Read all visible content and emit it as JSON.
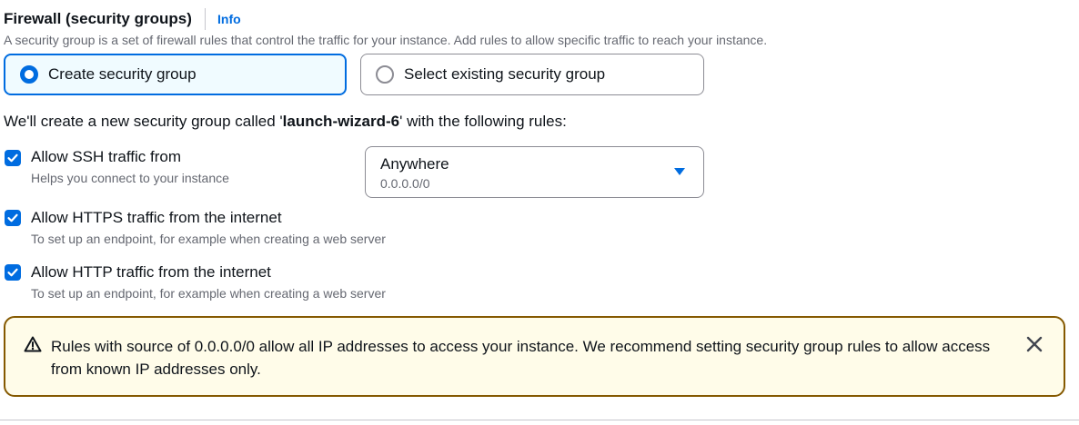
{
  "header": {
    "title": "Firewall (security groups)",
    "info_link": "Info",
    "description": "A security group is a set of firewall rules that control the traffic for your instance. Add rules to allow specific traffic to reach your instance."
  },
  "radio_options": {
    "create": {
      "label": "Create security group",
      "selected": true
    },
    "existing": {
      "label": "Select existing security group",
      "selected": false
    }
  },
  "summary": {
    "prefix": "We'll create a new security group called '",
    "group_name": "launch-wizard-6",
    "suffix": "' with the following rules:"
  },
  "rules": {
    "ssh": {
      "label": "Allow SSH traffic from",
      "description": "Helps you connect to your instance",
      "checked": true,
      "source": {
        "value": "Anywhere",
        "description": "0.0.0.0/0"
      }
    },
    "https": {
      "label": "Allow HTTPS traffic from the internet",
      "description": "To set up an endpoint, for example when creating a web server",
      "checked": true
    },
    "http": {
      "label": "Allow HTTP traffic from the internet",
      "description": "To set up an endpoint, for example when creating a web server",
      "checked": true
    }
  },
  "warning": {
    "text": "Rules with source of 0.0.0.0/0 allow all IP addresses to access your instance. We recommend setting security group rules to allow access from known IP addresses only.",
    "icon": "warning-triangle-icon",
    "dismiss_icon": "close-icon"
  },
  "colors": {
    "accent": "#006ce0",
    "warning_border": "#855900",
    "warning_background": "#fffce9",
    "selected_tile_background": "#f0fbff"
  }
}
